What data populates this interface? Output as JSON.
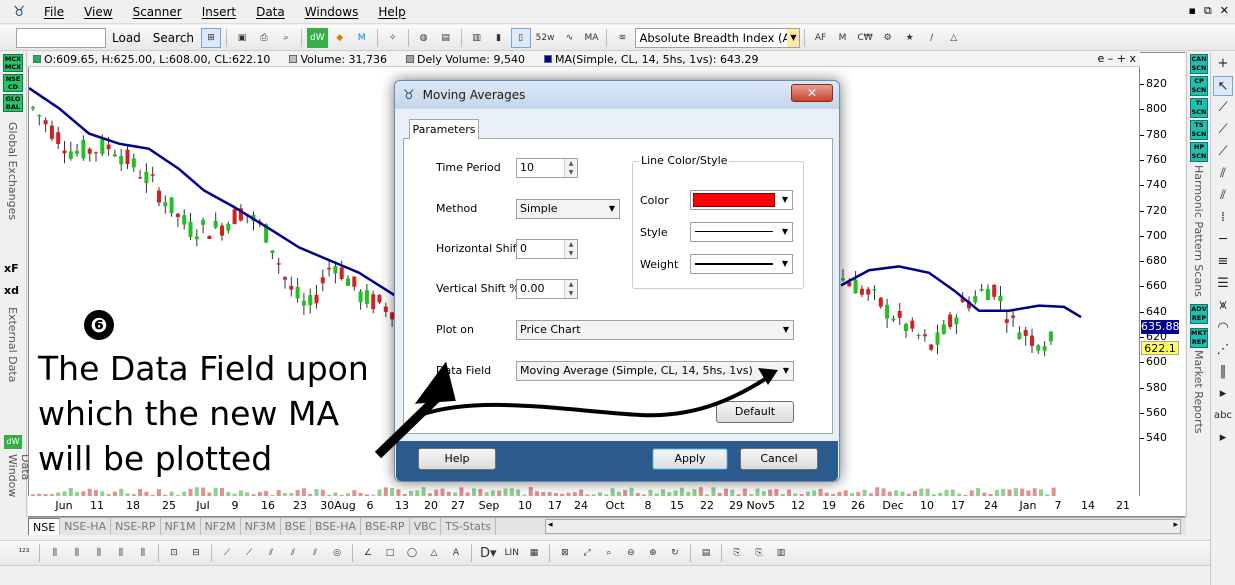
{
  "menubar": {
    "items": [
      "File",
      "View",
      "Scanner",
      "Insert",
      "Data",
      "Windows",
      "Help"
    ],
    "window_controls": [
      "▪",
      "⧉",
      "✕"
    ]
  },
  "toolbar": {
    "load_label": "Load",
    "search_label": "Search",
    "indicator_select": "Absolute Breadth Index (ABI",
    "dw": "dW",
    "mx": "M"
  },
  "left_strip": {
    "buttons": [
      "MCX MCX",
      "NSE CD",
      "GLO BAL"
    ],
    "global_label": "Global Exchanges",
    "external_label": "External Data",
    "data_window_label": "Data Window",
    "dw": "dW",
    "xf": "xF",
    "xd": "xd"
  },
  "infobar": {
    "ohlc": "O:609.65, H:625.00, L:608.00, CL:622.10",
    "volume": "Volume: 31,736",
    "dely": "Dely Volume: 9,540",
    "ma": "MA(Simple, CL, 14, 5hs, 1vs): 643.29",
    "controls": "e – + x"
  },
  "colors": {
    "ohlc_sq": "#22b14c",
    "volume_sq": "#c0c0c0",
    "dely_sq": "#a0a0a0",
    "ma_sq": "#0000a0",
    "ma_line": "#00008b",
    "up_candle": "#22c022",
    "down_candle": "#d42020",
    "color_swatch": "#ff0000"
  },
  "yaxis": {
    "ticks": [
      "820",
      "800",
      "780",
      "760",
      "740",
      "720",
      "700",
      "680",
      "660",
      "640",
      "620",
      "600",
      "580",
      "560",
      "540"
    ]
  },
  "price_tags": {
    "ma": "635.88",
    "close": "622.1"
  },
  "right_strip": {
    "buttons": [
      "CAN SCN",
      "CP SCN",
      "TI SCN",
      "TS SCN",
      "HP SCN",
      "ADV REP",
      "MKT REP"
    ],
    "harmonic_label": "Harmonic Pattern Scans",
    "market_label": "Market Reports"
  },
  "xaxis": {
    "ticks": [
      "Jun",
      "11",
      "18",
      "25",
      "Jul",
      "9",
      "16",
      "23",
      "30Aug",
      "6",
      "13",
      "20",
      "27",
      "Sep",
      "10",
      "17",
      "24",
      "Oct",
      "8",
      "15",
      "22",
      "29 Nov5",
      "12",
      "19",
      "26",
      "Dec",
      "10",
      "17",
      "24",
      "Jan",
      "7",
      "14",
      "21"
    ]
  },
  "exchange_tabs": [
    "NSE",
    "NSE-HA",
    "NSE-RP",
    "NF1M",
    "NF2M",
    "NF3M",
    "BSE",
    "BSE-HA",
    "BSE-RP",
    "VBC",
    "TS-Stats"
  ],
  "dialog": {
    "title": "Moving Averages",
    "close": "✕",
    "tab": "Parameters",
    "time_period": {
      "label": "Time Period",
      "value": "10"
    },
    "method": {
      "label": "Method",
      "value": "Simple"
    },
    "h_shift": {
      "label": "Horizontal Shift",
      "value": "0"
    },
    "v_shift": {
      "label": "Vertical Shift %",
      "value": "0.00"
    },
    "plot_on": {
      "label": "Plot on",
      "value": "Price Chart"
    },
    "data_field": {
      "label": "Data Field",
      "value": "Moving Average (Simple, CL, 14, 5hs, 1vs)"
    },
    "line_group": "Line Color/Style",
    "color_label": "Color",
    "style_label": "Style",
    "weight_label": "Weight",
    "default_btn": "Default",
    "help_btn": "Help",
    "apply_btn": "Apply",
    "cancel_btn": "Cancel"
  },
  "annotation": {
    "number": "❻",
    "text": "The Data Field upon which the new MA will be plotted"
  }
}
